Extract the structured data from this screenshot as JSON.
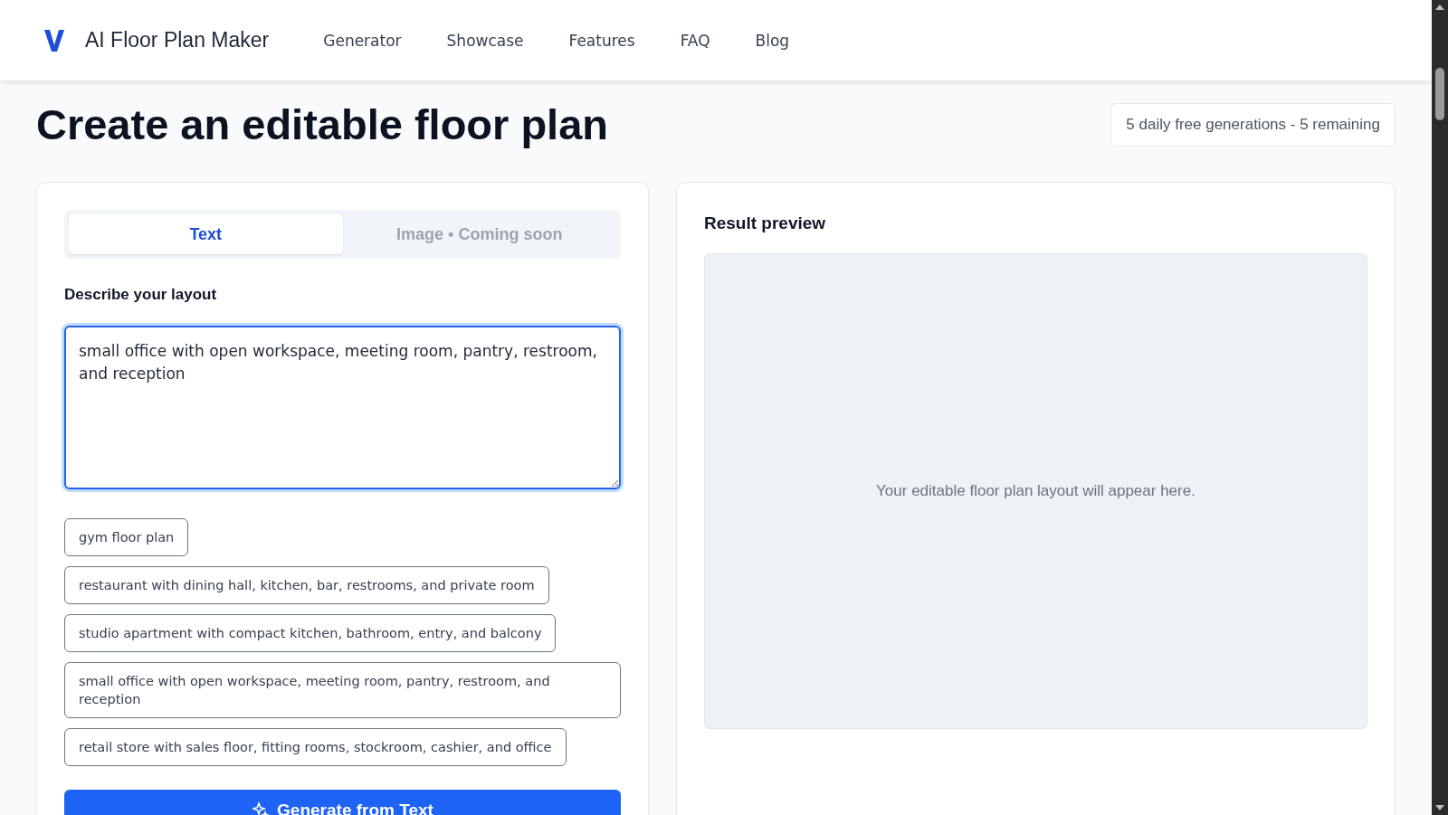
{
  "header": {
    "brand": "AI Floor Plan Maker",
    "nav": [
      {
        "label": "Generator"
      },
      {
        "label": "Showcase"
      },
      {
        "label": "Features"
      },
      {
        "label": "FAQ"
      },
      {
        "label": "Blog"
      }
    ]
  },
  "title": "Create an editable floor plan",
  "quota": "5 daily free generations - 5 remaining",
  "input_panel": {
    "tabs": [
      {
        "label": "Text",
        "selected": true
      },
      {
        "label": "Image • Coming soon",
        "selected": false
      }
    ],
    "field_label": "Describe your layout",
    "prompt": "small office with open workspace, meeting room, pantry, restroom, and reception",
    "suggestions": [
      "gym floor plan",
      "restaurant with dining hall, kitchen, bar, restrooms, and private room",
      "studio apartment with compact kitchen, bathroom, entry, and balcony",
      "small office with open workspace, meeting room, pantry, restroom, and reception",
      "retail store with sales floor, fitting rooms, stockroom, cashier, and office"
    ],
    "generate_button": "Generate from Text"
  },
  "result_panel": {
    "heading": "Result preview",
    "empty_message": "Your editable floor plan layout will appear here."
  }
}
